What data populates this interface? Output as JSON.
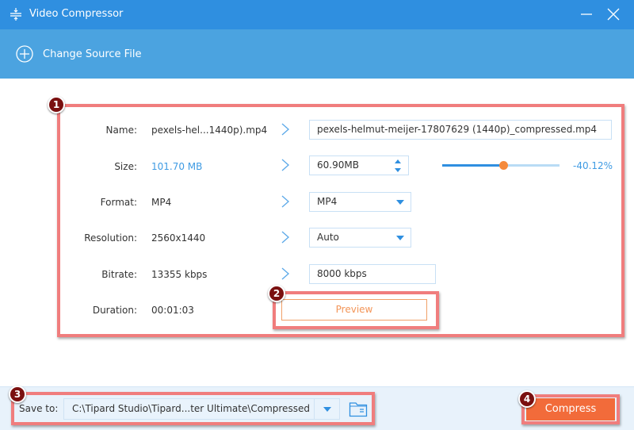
{
  "window": {
    "title": "Video Compressor",
    "icons": {
      "app": "compress-icon",
      "minimize": "minimize-icon",
      "close": "close-icon"
    }
  },
  "toolbar": {
    "change_source_label": "Change Source File",
    "change_source_icon": "plus-circle-icon"
  },
  "form": {
    "name": {
      "label": "Name:",
      "source": "pexels-hel...1440p).mp4",
      "output": "pexels-helmut-meijer-17807629 (1440p)_compressed.mp4"
    },
    "size": {
      "label": "Size:",
      "source": "101.70 MB",
      "output": "60.90MB",
      "slider_percent": 52,
      "change_label": "-40.12%"
    },
    "format": {
      "label": "Format:",
      "source": "MP4",
      "selected": "MP4"
    },
    "resolution": {
      "label": "Resolution:",
      "source": "2560x1440",
      "selected": "Auto"
    },
    "bitrate": {
      "label": "Bitrate:",
      "source": "13355 kbps",
      "output": "8000 kbps"
    },
    "duration": {
      "label": "Duration:",
      "source": "00:01:03"
    },
    "preview_label": "Preview"
  },
  "bottom": {
    "save_to_label": "Save to:",
    "save_path": "C:\\Tipard Studio\\Tipard...ter Ultimate\\Compressed",
    "compress_label": "Compress"
  },
  "annotations": [
    "1",
    "2",
    "3",
    "4"
  ],
  "colors": {
    "titlebar": "#2f8fe0",
    "toolbar": "#4ba3e0",
    "accent_blue": "#3f9be3",
    "accent_orange": "#f26b3a",
    "annotation_border": "#f07d7d",
    "badge": "#7a1010"
  }
}
